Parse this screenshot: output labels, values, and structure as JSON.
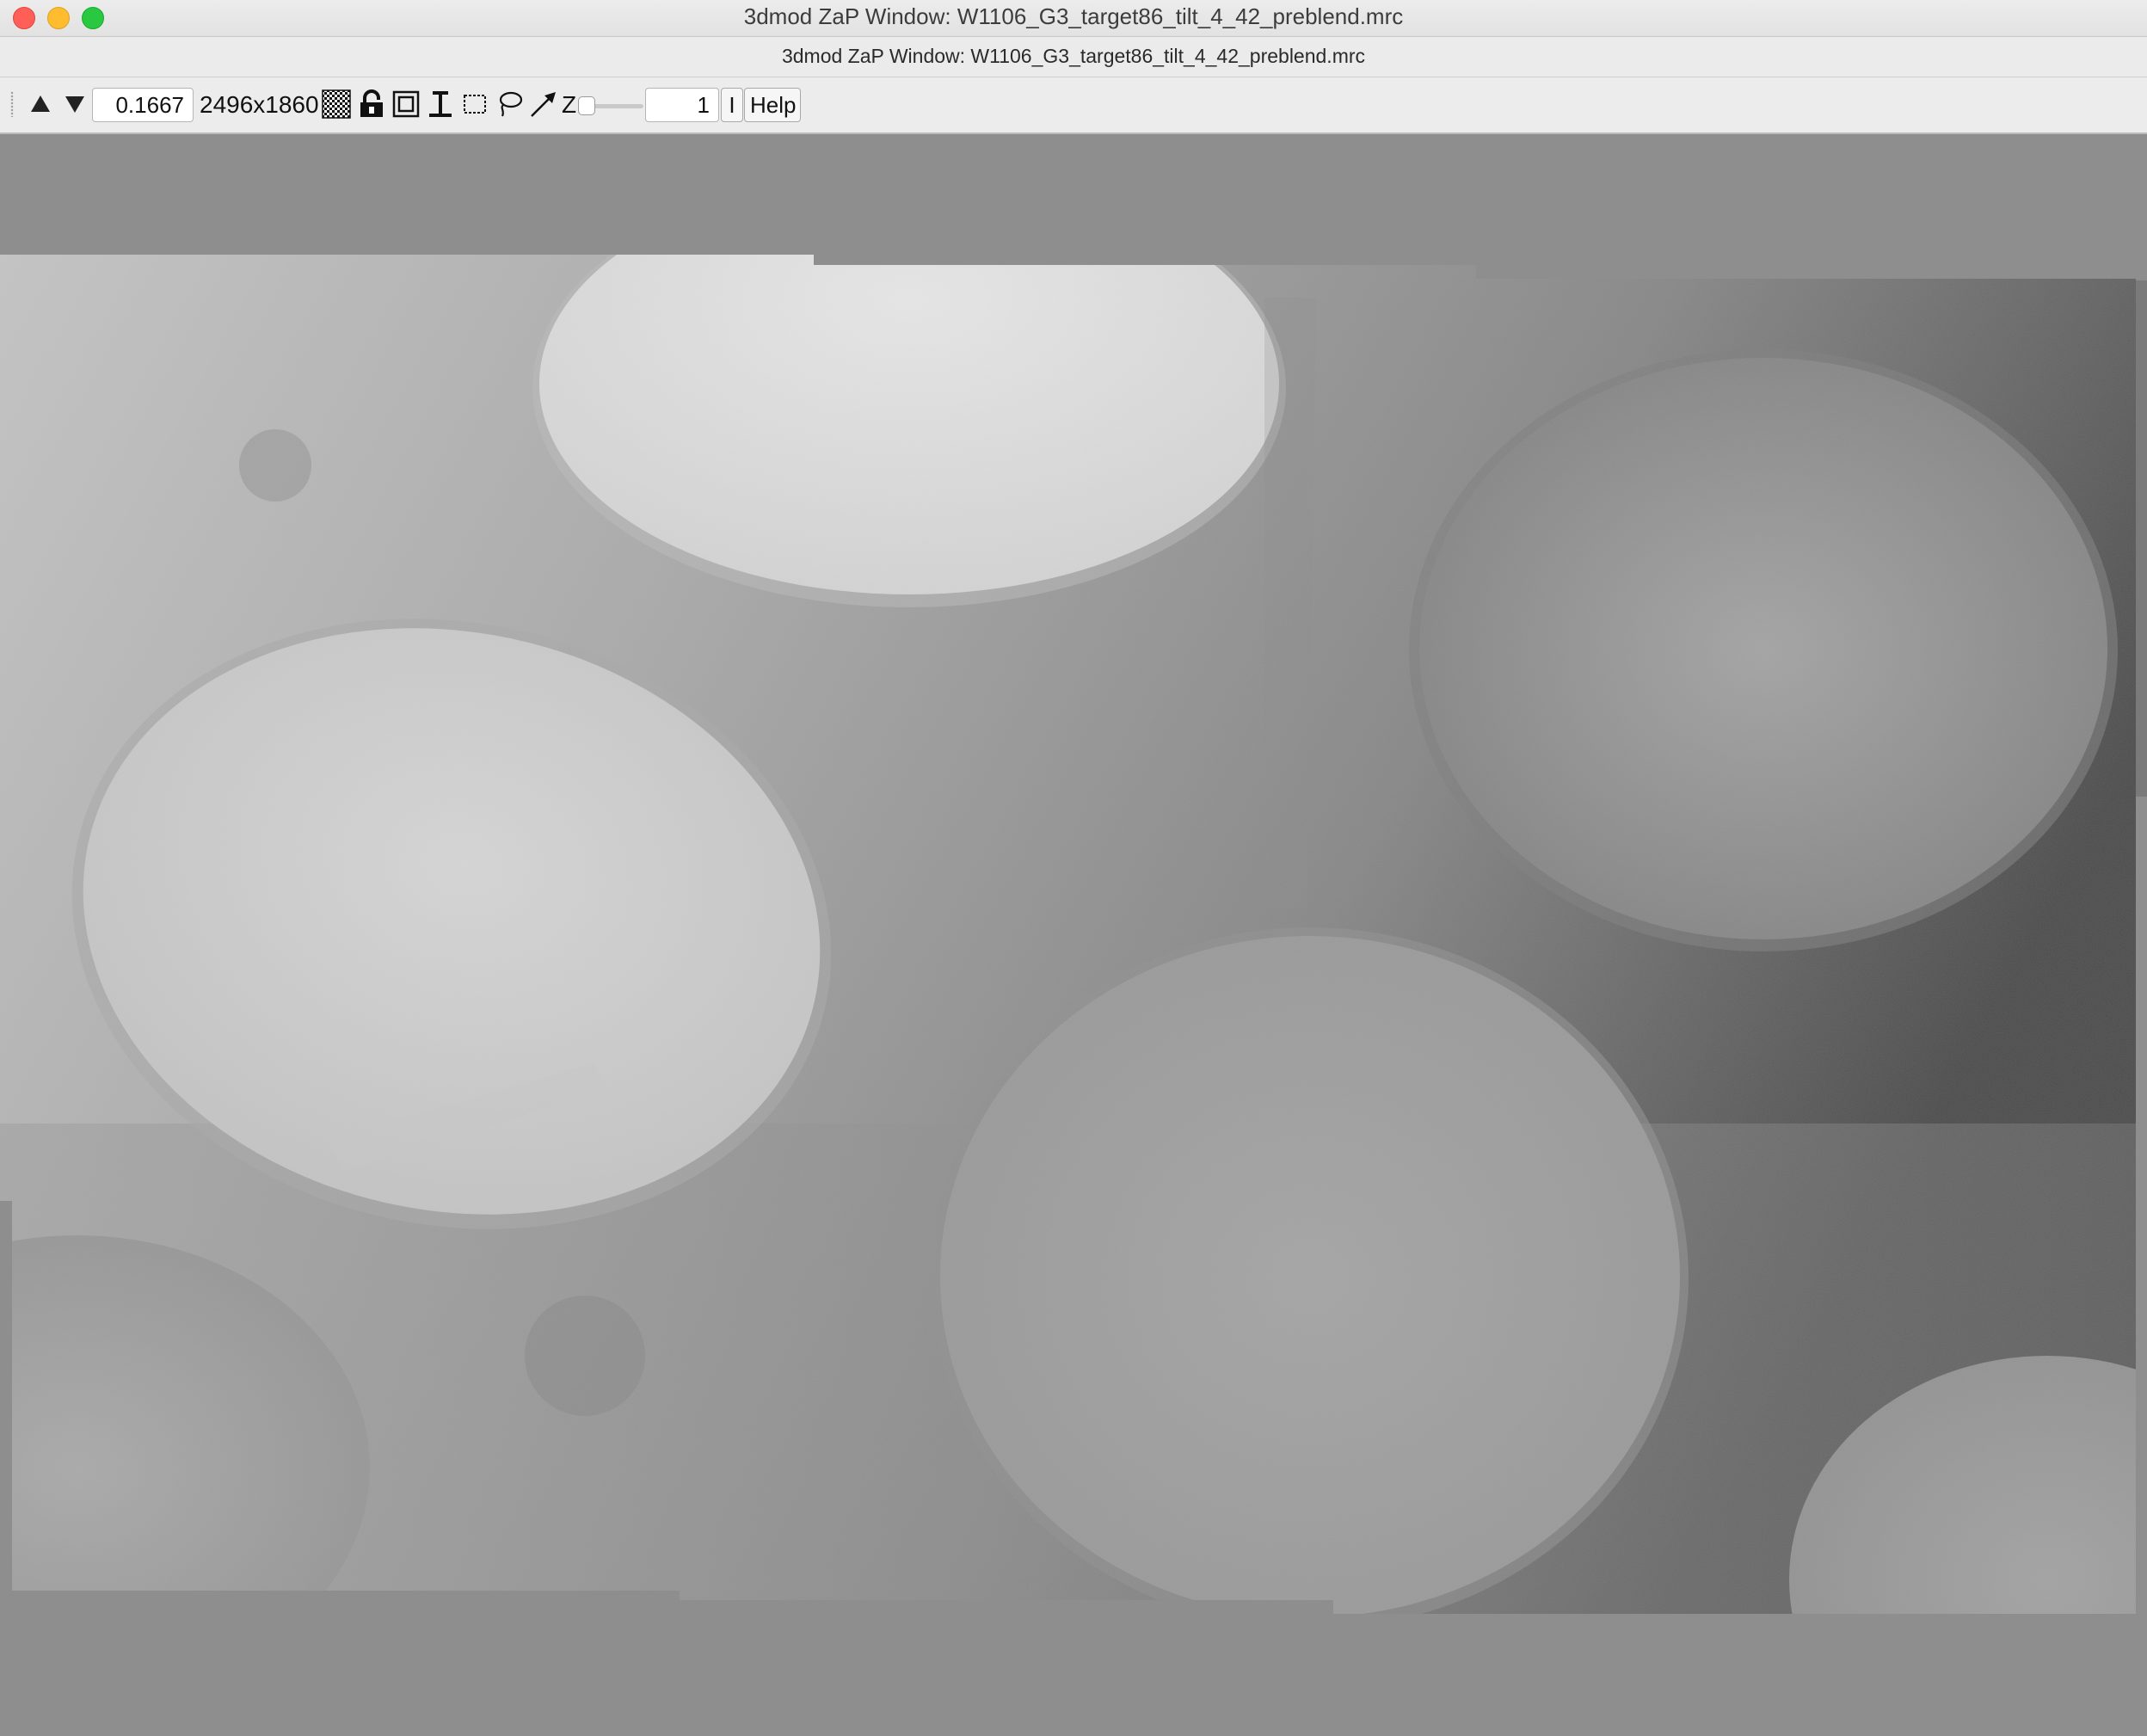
{
  "window": {
    "title": "3dmod ZaP Window: W1106_G3_target86_tilt_4_42_preblend.mrc",
    "subtitle": "3dmod ZaP Window: W1106_G3_target86_tilt_4_42_preblend.mrc"
  },
  "toolbar": {
    "zoom_value": "0.1667",
    "image_size": "2496x1860",
    "z_label": "Z",
    "z_value": "1",
    "info_label": "I",
    "help_label": "Help",
    "z_slider_fraction": 0.0
  },
  "icons": [
    "zoom-up-arrow-icon",
    "zoom-down-arrow-icon",
    "checkerboard-icon",
    "lock-icon",
    "center-box-icon",
    "time-lock-icon",
    "rubberband-icon",
    "lasso-icon",
    "arrow-icon"
  ],
  "colors": {
    "background": "#8e8e8e",
    "toolbar": "#ececec",
    "close": "#ff5f57",
    "minimize": "#febc2e",
    "maximize": "#28c840"
  }
}
